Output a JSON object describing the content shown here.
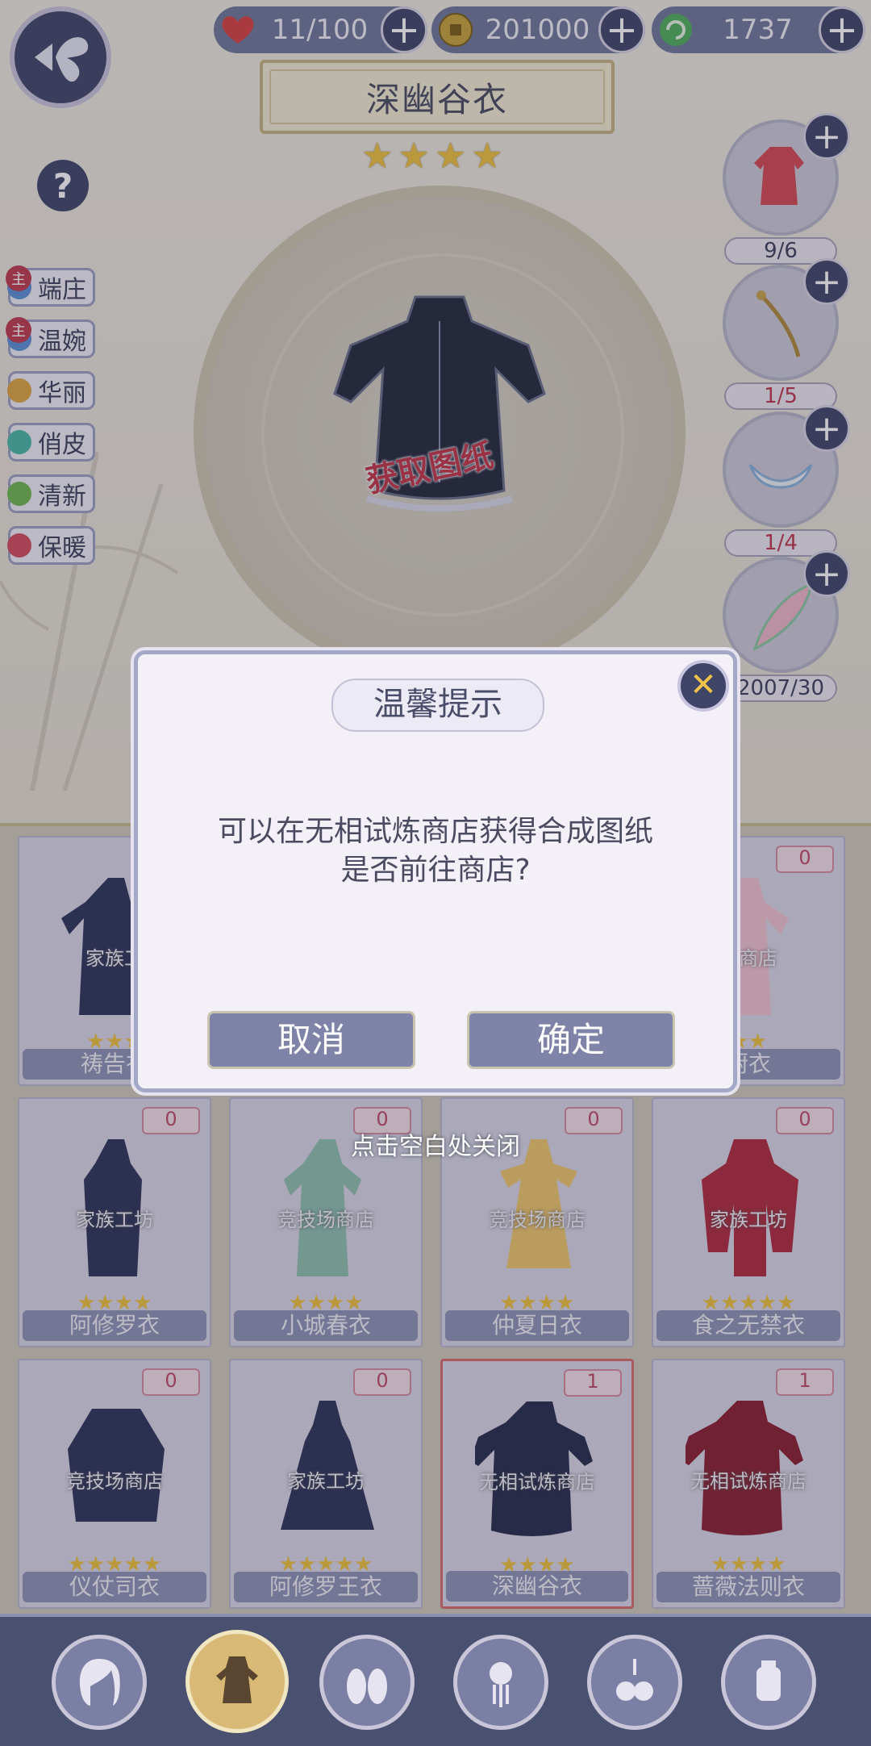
{
  "header": {
    "resources": [
      {
        "icon": "heart-icon",
        "value": "11/100",
        "color": "#d9413f"
      },
      {
        "icon": "coin-icon",
        "value": "201000",
        "color": "#c8a23a"
      },
      {
        "icon": "gem-icon",
        "value": "1737",
        "color": "#4fae5a"
      }
    ]
  },
  "item": {
    "title": "深幽谷衣",
    "stars": 4,
    "stamp": "获取图纸"
  },
  "tags": [
    {
      "label": "端庄",
      "main": "主",
      "color": "#5b8fd6"
    },
    {
      "label": "温婉",
      "main": "主",
      "color": "#5b8fd6"
    },
    {
      "label": "华丽",
      "main": "",
      "color": "#e0a43c"
    },
    {
      "label": "俏皮",
      "main": "",
      "color": "#49b8a6"
    },
    {
      "label": "清新",
      "main": "",
      "color": "#6cb84a"
    },
    {
      "label": "保暖",
      "main": "",
      "color": "#d6495a"
    }
  ],
  "materials": [
    {
      "count": "9/6",
      "count_color": "#3c3f59",
      "icon": "qipao-icon"
    },
    {
      "count": "1/5",
      "count_color": "#c0344a",
      "icon": "hairpin-icon"
    },
    {
      "count": "1/4",
      "count_color": "#c0344a",
      "icon": "lace-collar-icon"
    },
    {
      "count": "2007/30",
      "count_color": "#3c3f59",
      "icon": "feather-icon"
    }
  ],
  "cards": [
    {
      "name": "祷告衣",
      "source": "家族工",
      "stars": 3,
      "badge": ""
    },
    {
      "name": "",
      "source": "",
      "stars": 0,
      "badge": ""
    },
    {
      "name": "",
      "source": "",
      "stars": 0,
      "badge": ""
    },
    {
      "name": "厨衣",
      "source": "场商店",
      "stars": 2,
      "badge": "0"
    },
    {
      "name": "阿修罗衣",
      "source": "家族工坊",
      "stars": 4,
      "badge": "0"
    },
    {
      "name": "小城春衣",
      "source": "竞技场商店",
      "stars": 4,
      "badge": "0"
    },
    {
      "name": "仲夏日衣",
      "source": "竞技场商店",
      "stars": 4,
      "badge": "0"
    },
    {
      "name": "食之无禁衣",
      "source": "家族工坊",
      "stars": 5,
      "badge": "0"
    },
    {
      "name": "仪仗司衣",
      "source": "竞技场商店",
      "stars": 5,
      "badge": "0"
    },
    {
      "name": "阿修罗王衣",
      "source": "家族工坊",
      "stars": 5,
      "badge": "0"
    },
    {
      "name": "深幽谷衣",
      "source": "无相试炼商店",
      "stars": 4,
      "badge": "1"
    },
    {
      "name": "蔷薇法则衣",
      "source": "无相试炼商店",
      "stars": 4,
      "badge": "1"
    }
  ],
  "dialog": {
    "title": "温馨提示",
    "message_line1": "可以在无相试炼商店获得合成图纸",
    "message_line2": "是否前往商店?",
    "cancel_label": "取消",
    "confirm_label": "确定",
    "close_hint": "点击空白处关闭"
  },
  "nav": [
    "hairstyle-icon",
    "dress-icon",
    "shoes-icon",
    "hair-ornament-icon",
    "accessory-icon",
    "lantern-icon"
  ]
}
